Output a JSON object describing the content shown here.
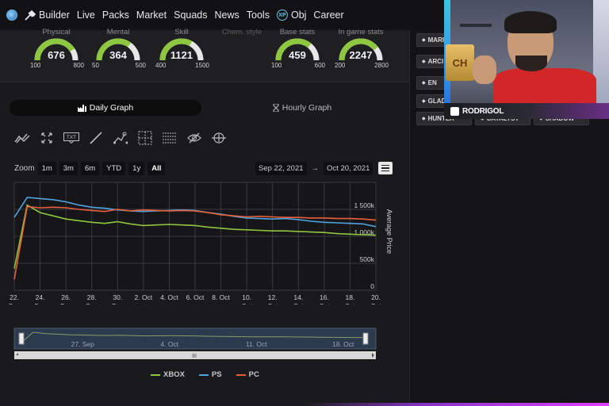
{
  "nav": {
    "items": [
      {
        "label": "Builder",
        "icon": "tools-icon"
      },
      {
        "label": "Live",
        "icon": ""
      },
      {
        "label": "Packs",
        "icon": ""
      },
      {
        "label": "Market",
        "icon": ""
      },
      {
        "label": "Squads",
        "icon": ""
      },
      {
        "label": "News",
        "icon": ""
      },
      {
        "label": "Tools",
        "icon": ""
      },
      {
        "label": "Obj",
        "icon": "xp-icon"
      },
      {
        "label": "Career",
        "icon": ""
      }
    ],
    "xp_badge": "XP"
  },
  "gauges": [
    {
      "title": "Physical",
      "value": "676",
      "min": "100",
      "max": "800",
      "fraction": 0.82
    },
    {
      "title": "Mental",
      "value": "364",
      "min": "50",
      "max": "500",
      "fraction": 0.7
    },
    {
      "title": "Skill",
      "value": "1121",
      "min": "400",
      "max": "1500",
      "fraction": 0.66
    },
    {
      "title": "Chem. style",
      "value": "",
      "min": "",
      "max": "",
      "fraction": 0
    },
    {
      "title": "Base stats",
      "value": "459",
      "min": "100",
      "max": "600",
      "fraction": 0.72
    },
    {
      "title": "In game stats",
      "value": "2247",
      "min": "200",
      "max": "2800",
      "fraction": 0.79
    }
  ],
  "graph_tabs": {
    "daily": "Daily Graph",
    "hourly": "Hourly Graph"
  },
  "toolbar": [
    "trend-icon",
    "fullscreen-icon",
    "text-icon",
    "line-icon",
    "path-icon",
    "crosshair-icon",
    "grid-icon",
    "hide-icon",
    "zoom-icon"
  ],
  "toolbar_text_label": "TXT",
  "zoom": {
    "label": "Zoom",
    "buttons": [
      "1m",
      "3m",
      "6m",
      "YTD",
      "1y",
      "All"
    ],
    "active": "All"
  },
  "date_range": {
    "from": "Sep 22, 2021",
    "arrow": "→",
    "to": "Oct 20, 2021"
  },
  "chart_data": {
    "type": "line",
    "ylabel": "Average Price",
    "ylim": [
      0,
      2000000
    ],
    "yticks": [
      0,
      500000,
      1000000,
      1500000
    ],
    "ytick_labels": [
      "0",
      "500k",
      "1 000k",
      "1 500k"
    ],
    "xticks": [
      {
        "day": 22,
        "label": [
          "22.",
          "Sep"
        ]
      },
      {
        "day": 24,
        "label": [
          "24.",
          "Sep"
        ]
      },
      {
        "day": 26,
        "label": [
          "26.",
          "Sep"
        ]
      },
      {
        "day": 28,
        "label": [
          "28.",
          "Sep"
        ]
      },
      {
        "day": 30,
        "label": [
          "30.",
          "Sep"
        ]
      },
      {
        "day": 32,
        "label": [
          "2. Oct",
          ""
        ]
      },
      {
        "day": 34,
        "label": [
          "4. Oct",
          ""
        ]
      },
      {
        "day": 36,
        "label": [
          "6. Oct",
          ""
        ]
      },
      {
        "day": 38,
        "label": [
          "8. Oct",
          ""
        ]
      },
      {
        "day": 40,
        "label": [
          "10.",
          "Oct"
        ]
      },
      {
        "day": 42,
        "label": [
          "12.",
          "Oct"
        ]
      },
      {
        "day": 44,
        "label": [
          "14.",
          "Oct"
        ]
      },
      {
        "day": 46,
        "label": [
          "16.",
          "Oct"
        ]
      },
      {
        "day": 48,
        "label": [
          "18.",
          "Oct"
        ]
      },
      {
        "day": 50,
        "label": [
          "20.",
          "Oct"
        ]
      }
    ],
    "xlim": [
      22,
      50
    ],
    "series": [
      {
        "name": "XBOX",
        "color": "#8dc63f",
        "points": [
          [
            22,
            400000
          ],
          [
            23,
            1580000
          ],
          [
            24,
            1440000
          ],
          [
            25,
            1380000
          ],
          [
            26,
            1320000
          ],
          [
            27,
            1290000
          ],
          [
            28,
            1260000
          ],
          [
            29,
            1240000
          ],
          [
            30,
            1270000
          ],
          [
            31,
            1230000
          ],
          [
            32,
            1200000
          ],
          [
            33,
            1210000
          ],
          [
            34,
            1220000
          ],
          [
            35,
            1210000
          ],
          [
            36,
            1200000
          ],
          [
            37,
            1170000
          ],
          [
            38,
            1150000
          ],
          [
            39,
            1130000
          ],
          [
            40,
            1120000
          ],
          [
            41,
            1110000
          ],
          [
            42,
            1100000
          ],
          [
            43,
            1100000
          ],
          [
            44,
            1090000
          ],
          [
            45,
            1080000
          ],
          [
            46,
            1070000
          ],
          [
            47,
            1050000
          ],
          [
            48,
            1040000
          ],
          [
            49,
            1030000
          ],
          [
            50,
            1020000
          ]
        ]
      },
      {
        "name": "PS",
        "color": "#4fa3e0",
        "points": [
          [
            22,
            1350000
          ],
          [
            23,
            1720000
          ],
          [
            24,
            1700000
          ],
          [
            25,
            1680000
          ],
          [
            26,
            1640000
          ],
          [
            27,
            1580000
          ],
          [
            28,
            1540000
          ],
          [
            29,
            1520000
          ],
          [
            30,
            1490000
          ],
          [
            31,
            1470000
          ],
          [
            32,
            1460000
          ],
          [
            33,
            1470000
          ],
          [
            34,
            1480000
          ],
          [
            35,
            1490000
          ],
          [
            36,
            1480000
          ],
          [
            37,
            1440000
          ],
          [
            38,
            1410000
          ],
          [
            39,
            1370000
          ],
          [
            40,
            1340000
          ],
          [
            41,
            1330000
          ],
          [
            42,
            1320000
          ],
          [
            43,
            1330000
          ],
          [
            44,
            1310000
          ],
          [
            45,
            1280000
          ],
          [
            46,
            1260000
          ],
          [
            47,
            1250000
          ],
          [
            48,
            1240000
          ],
          [
            49,
            1230000
          ],
          [
            50,
            1180000
          ]
        ]
      },
      {
        "name": "PC",
        "color": "#e8603c",
        "points": [
          [
            22,
            200000
          ],
          [
            23,
            1550000
          ],
          [
            24,
            1530000
          ],
          [
            25,
            1540000
          ],
          [
            26,
            1530000
          ],
          [
            27,
            1500000
          ],
          [
            28,
            1480000
          ],
          [
            29,
            1460000
          ],
          [
            30,
            1500000
          ],
          [
            31,
            1470000
          ],
          [
            32,
            1490000
          ],
          [
            33,
            1480000
          ],
          [
            34,
            1470000
          ],
          [
            35,
            1480000
          ],
          [
            36,
            1470000
          ],
          [
            37,
            1440000
          ],
          [
            38,
            1400000
          ],
          [
            39,
            1380000
          ],
          [
            40,
            1360000
          ],
          [
            41,
            1370000
          ],
          [
            42,
            1360000
          ],
          [
            43,
            1350000
          ],
          [
            44,
            1350000
          ],
          [
            45,
            1340000
          ],
          [
            46,
            1340000
          ],
          [
            47,
            1330000
          ],
          [
            48,
            1330000
          ],
          [
            49,
            1320000
          ],
          [
            50,
            1300000
          ]
        ]
      }
    ],
    "grid": true,
    "legend": "bottom-center"
  },
  "navigator": {
    "labels": [
      {
        "day": 27,
        "text": "27. Sep"
      },
      {
        "day": 34,
        "text": "4. Oct"
      },
      {
        "day": 41,
        "text": "11. Oct"
      },
      {
        "day": 48,
        "text": "18. Oct"
      }
    ],
    "scroll_grip": "III"
  },
  "right_buttons": [
    {
      "label": "MARI",
      "icon": "round-icon"
    },
    {
      "label": "ARCI",
      "icon": "a-icon"
    },
    {
      "label": "EN",
      "icon": "hand-icon"
    },
    {
      "label": "GLAD",
      "icon": "sword-icon"
    },
    {
      "label": "HUNTER",
      "icon": "target-icon"
    },
    {
      "label": "CATALYST",
      "icon": "flask-icon"
    },
    {
      "label": "SHADOW",
      "icon": "shadow-icon"
    }
  ],
  "webcam": {
    "name": "RODRIGOL",
    "card_text": "CH"
  },
  "colors": {
    "nav_bg": "#121214",
    "panel_bg": "#1a1a1c",
    "xbox": "#8dc63f",
    "ps": "#4fa3e0",
    "pc": "#e8603c",
    "gauge_green": "#8dc63f"
  }
}
